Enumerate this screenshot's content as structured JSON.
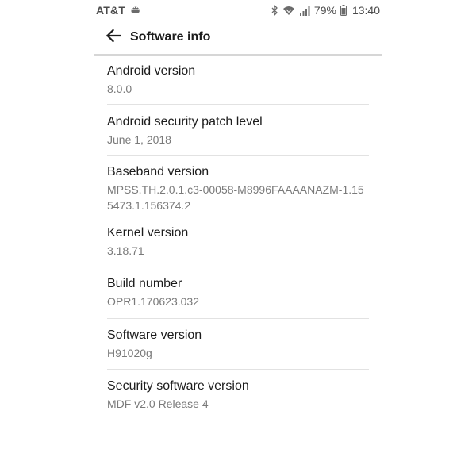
{
  "status_bar": {
    "carrier": "AT&T",
    "battery_percent": "79%",
    "time": "13:40",
    "icons": [
      "android-icon",
      "bluetooth-icon",
      "wifi-icon",
      "signal-icon",
      "battery-icon"
    ]
  },
  "app_bar": {
    "title": "Software info",
    "back_icon": "arrow-back-icon"
  },
  "items": [
    {
      "title": "Android version",
      "value": "8.0.0"
    },
    {
      "title": "Android security patch level",
      "value": "June 1, 2018"
    },
    {
      "title": "Baseband version",
      "value": "MPSS.TH.2.0.1.c3-00058-M8996FAAAANAZM-1.155473.1.156374.2"
    },
    {
      "title": "Kernel version",
      "value": "3.18.71"
    },
    {
      "title": "Build number",
      "value": "OPR1.170623.032"
    },
    {
      "title": "Software version",
      "value": "H91020g"
    },
    {
      "title": "Security software version",
      "value": "MDF v2.0 Release 4"
    }
  ],
  "colors": {
    "background": "#ffffff",
    "title_text": "#1c1c1c",
    "value_text": "#7a7a7a",
    "divider": "#e2e2e2"
  }
}
